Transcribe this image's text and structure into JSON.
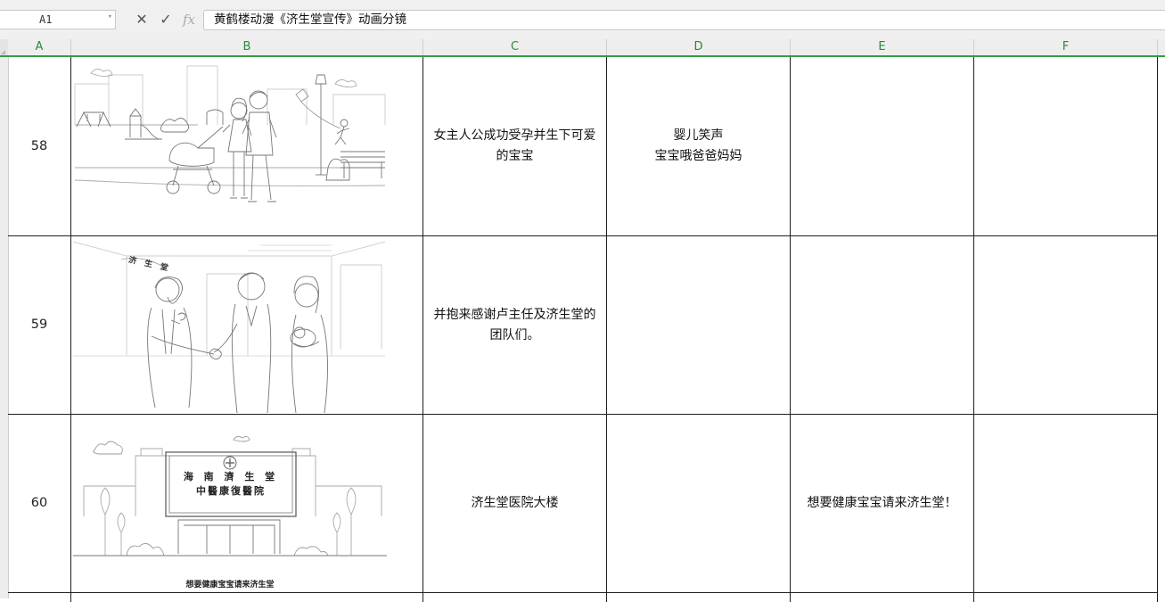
{
  "formula_bar": {
    "cell_ref": "A1",
    "formula_text": "黄鹤楼动漫《济生堂宣传》动画分镜",
    "cancel_icon": "close-icon",
    "confirm_icon": "check-icon",
    "fx_label": "fx"
  },
  "columns": [
    "A",
    "B",
    "C",
    "D",
    "E",
    "F"
  ],
  "rows": [
    {
      "number": "58",
      "sketch": "park-family-stroller-sketch",
      "c": "女主人公成功受孕并生下可爱\n的宝宝",
      "d": "婴儿笑声\n宝宝哦爸爸妈妈",
      "e": "",
      "f": ""
    },
    {
      "number": "59",
      "sketch": "doctor-handshake-sketch",
      "sketch_sign": "济 生 堂",
      "c": "并抱来感谢卢主任及济生堂的\n团队们。",
      "d": "",
      "e": "",
      "f": ""
    },
    {
      "number": "60",
      "sketch": "hospital-building-sketch",
      "building_sign_line1": "海 南 濟 生 堂",
      "building_sign_line2": "中醫康復醫院",
      "sketch_caption": "想要健康宝宝请来济生堂",
      "c": "济生堂医院大楼",
      "d": "",
      "e": "想要健康宝宝请来济生堂！",
      "f": ""
    }
  ]
}
